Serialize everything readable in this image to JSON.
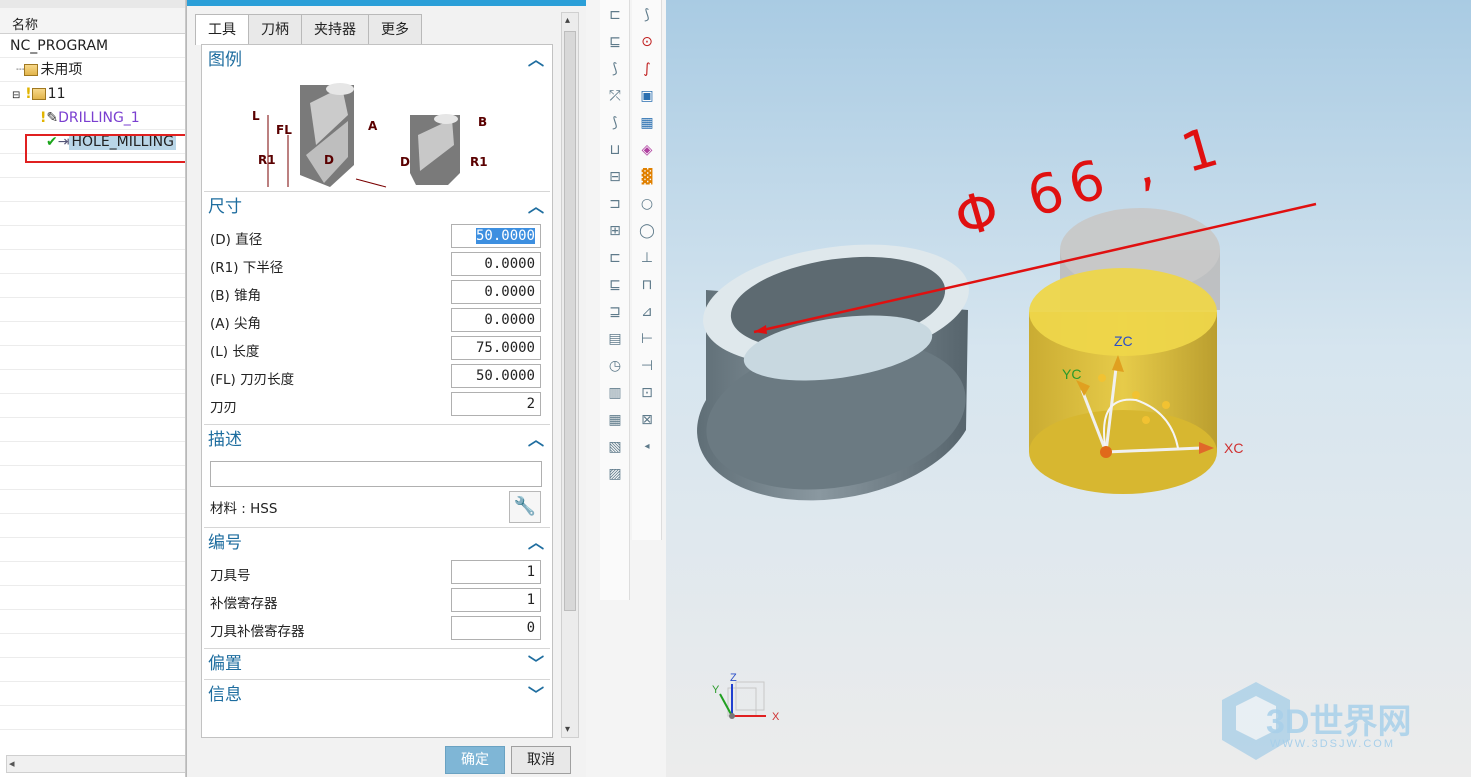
{
  "navigator": {
    "column_header": "名称",
    "rows": [
      {
        "label": "NC_PROGRAM"
      },
      {
        "label": "未用项"
      },
      {
        "label": "11"
      },
      {
        "label": "DRILLING_1"
      },
      {
        "label": "HOLE_MILLING"
      }
    ]
  },
  "dialog": {
    "tabs": [
      "工具",
      "刀柄",
      "夹持器",
      "更多"
    ],
    "sections": {
      "legend": "图例",
      "dimensions": "尺寸",
      "description": "描述",
      "numbering": "编号",
      "offset": "偏置",
      "info": "信息"
    },
    "diagram_labels": {
      "L": "L",
      "FL": "FL",
      "A": "A",
      "B": "B",
      "D": "D",
      "R1": "R1"
    },
    "dimensions": [
      {
        "label": "(D) 直径",
        "value": "50.0000"
      },
      {
        "label": "(R1) 下半径",
        "value": "0.0000"
      },
      {
        "label": "(B) 锥角",
        "value": "0.0000"
      },
      {
        "label": "(A) 尖角",
        "value": "0.0000"
      },
      {
        "label": "(L) 长度",
        "value": "75.0000"
      },
      {
        "label": "(FL) 刀刃长度",
        "value": "50.0000"
      },
      {
        "label": "刀刃",
        "value": "2"
      }
    ],
    "description_value": "",
    "material": "材料 : HSS",
    "numbering": [
      {
        "label": "刀具号",
        "value": "1"
      },
      {
        "label": "补偿寄存器",
        "value": "1"
      },
      {
        "label": "刀具补偿寄存器",
        "value": "0"
      }
    ],
    "ok": "确定",
    "cancel": "取消"
  },
  "viewport": {
    "annotation": "Φ 66 , 1",
    "axes": {
      "zc": "ZC",
      "yc": "YC",
      "xc": "XC"
    },
    "mini_axes": {
      "x": "X",
      "y": "Y",
      "z": "Z"
    },
    "watermark": "3D世界网",
    "watermark_url": "WWW.3DSJW.COM"
  },
  "colors": {
    "accent": "#1e6d9f",
    "annotation": "#e01010",
    "highlight": "#e02020"
  }
}
